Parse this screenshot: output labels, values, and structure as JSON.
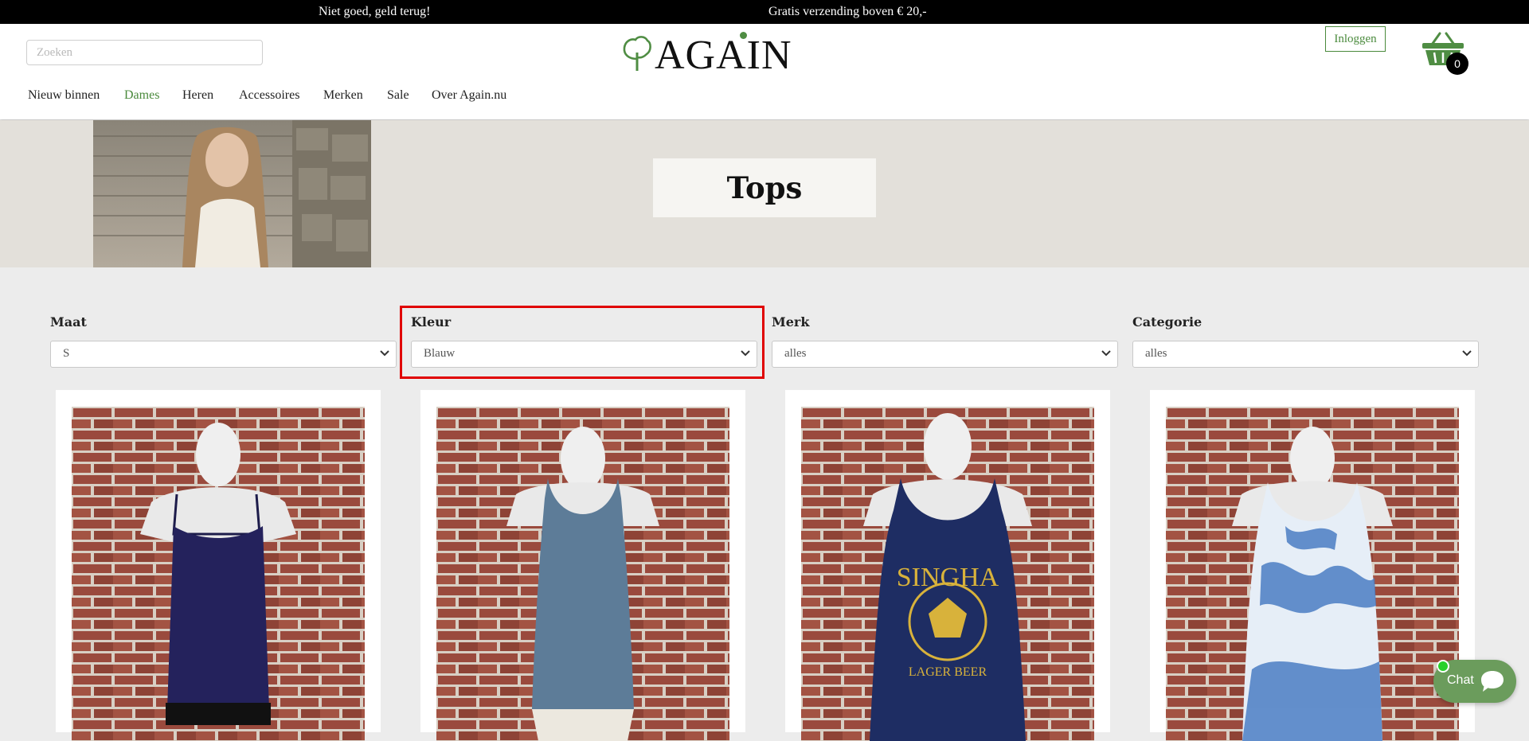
{
  "topbar": {
    "message1": "Niet goed, geld terug!",
    "message2": "Gratis verzending boven € 20,-"
  },
  "header": {
    "search_placeholder": "Zoeken",
    "logo_text": "AGAIN",
    "login_label": "Inloggen",
    "cart_count": "0"
  },
  "nav": {
    "items": [
      "Nieuw binnen",
      "Dames",
      "Heren",
      "Accessoires",
      "Merken",
      "Sale",
      "Over Again.nu"
    ],
    "active": "Dames"
  },
  "hero": {
    "title": "Tops"
  },
  "filters": [
    {
      "label": "Maat",
      "value": "S"
    },
    {
      "label": "Kleur",
      "value": "Blauw"
    },
    {
      "label": "Merk",
      "value": "alles"
    },
    {
      "label": "Categorie",
      "value": "alles"
    }
  ],
  "products": [
    {
      "desc": "navy-camisole-top"
    },
    {
      "desc": "blue-grey-racerback-tank"
    },
    {
      "desc": "navy-singha-tank"
    },
    {
      "desc": "blue-tie-dye-tank"
    }
  ],
  "chat": {
    "label": "Chat"
  },
  "colors": {
    "accent_green": "#4a8a3c",
    "highlight_red": "#e00000",
    "brick": "#9a4a3d"
  }
}
